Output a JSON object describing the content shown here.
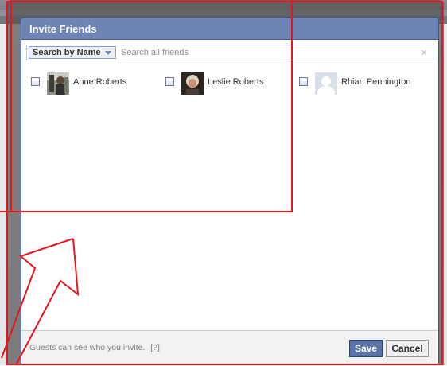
{
  "dialog": {
    "title": "Invite Friends",
    "search": {
      "filter_label": "Search by Name",
      "placeholder": "Search all friends",
      "clear_glyph": "×"
    },
    "friends": [
      {
        "name": "Anne Roberts",
        "checked": false,
        "avatar": "photo"
      },
      {
        "name": "Leslie Roberts",
        "checked": false,
        "avatar": "photo"
      },
      {
        "name": "Rhian Pennington",
        "checked": false,
        "avatar": "default-silhouette"
      }
    ],
    "footer": {
      "note": "Guests can see who you invite.",
      "help": "[?]",
      "save_label": "Save",
      "cancel_label": "Cancel"
    }
  },
  "colors": {
    "title_bar": "#6d84b4",
    "save_button": "#5b74a8",
    "annotation": "#e8141e"
  },
  "icons": {
    "caret": "chevron-down-icon",
    "clear": "close-icon",
    "annotation_arrow": "arrow-icon"
  }
}
